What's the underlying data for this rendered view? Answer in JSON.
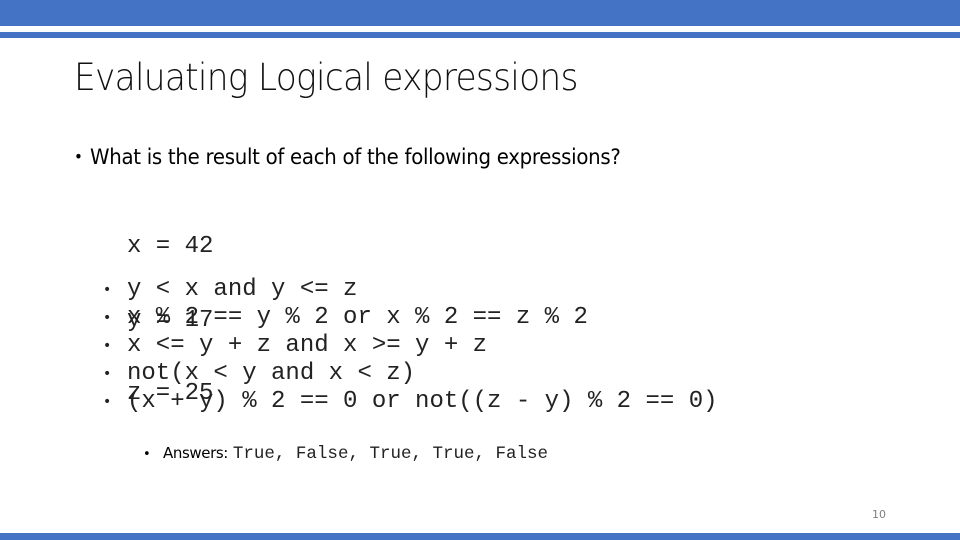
{
  "slide": {
    "title": "Evaluating Logical expressions",
    "question": "What is the result of each of the following expressions?",
    "bullet_glyph": "•",
    "declarations": [
      "x = 42",
      "y = 17",
      "z = 25"
    ],
    "expressions": [
      "y < x and y <= z",
      "x % 2 == y % 2 or x % 2 == z % 2",
      "x <= y + z and x >= y + z",
      "not(x < y and x < z)",
      "(x + y) % 2 == 0 or not((z - y) % 2 == 0)"
    ],
    "answers": {
      "label": "Answers:",
      "values": "True, False, True, True, False"
    },
    "page_number": "10"
  },
  "theme": {
    "accent": "#4472c4"
  }
}
